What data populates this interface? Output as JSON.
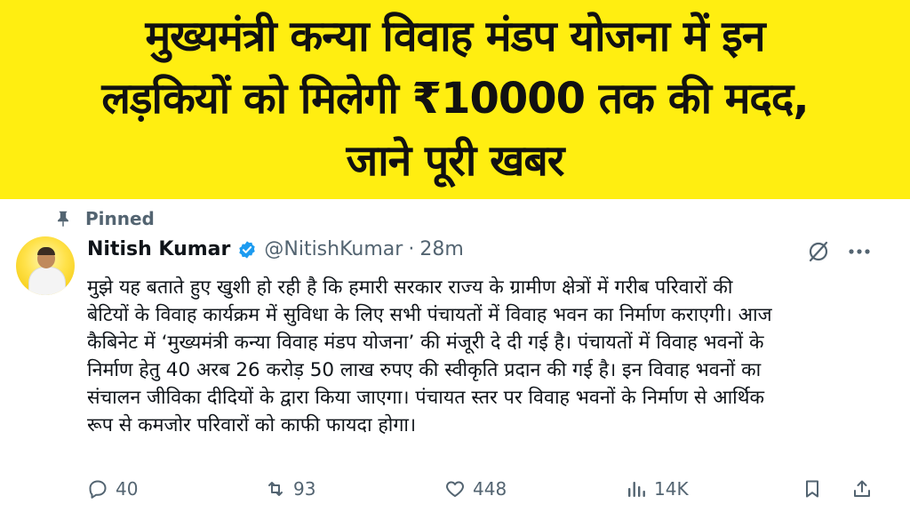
{
  "banner": {
    "title_lines": [
      "मुख्यमंत्री कन्या विवाह मंडप योजना में इन",
      "लड़कियों को मिलेगी ₹10000 तक की मदद,",
      "जाने पूरी खबर"
    ],
    "background_color": "#ffee11"
  },
  "tweet": {
    "pinned_label": "Pinned",
    "author_name": "Nitish Kumar",
    "handle": "@NitishKumar",
    "separator": "·",
    "time": "28m",
    "body_lines": [
      "मुझे यह बताते हुए खुशी हो रही है कि हमारी सरकार राज्य के ग्रामीण क्षेत्रों में गरीब परिवारों की",
      "बेटियों के विवाह कार्यक्रम में सुविधा के लिए सभी पंचायतों में विवाह भवन का निर्माण कराएगी। आज",
      "कैबिनेट में ‘मुख्यमंत्री कन्या विवाह मंडप योजना’ की मंजूरी दे दी गई है। पंचायतों में विवाह भवनों के",
      "निर्माण हेतु 40 अरब 26 करोड़ 50 लाख रुपए की स्वीकृति प्रदान की गई है। इन विवाह भवनों का",
      "संचालन जीविका दीदियों के द्वारा किया जाएगा। पंचायत स्तर पर विवाह भवनों के निर्माण से आर्थिक",
      "रूप से कमजोर परिवारों को काफी फायदा होगा।"
    ],
    "actions": {
      "replies": "40",
      "reposts": "93",
      "likes": "448",
      "views": "14K"
    },
    "icons": {
      "pin": "pin-icon",
      "verified": "verified-badge-icon",
      "grok": "grok-icon",
      "more": "more-icon",
      "reply": "reply-icon",
      "repost": "repost-icon",
      "like": "heart-icon",
      "views": "views-chart-icon",
      "bookmark": "bookmark-icon",
      "share": "share-icon"
    },
    "accent_color": "#1d9bf0",
    "muted_color": "#536471"
  }
}
